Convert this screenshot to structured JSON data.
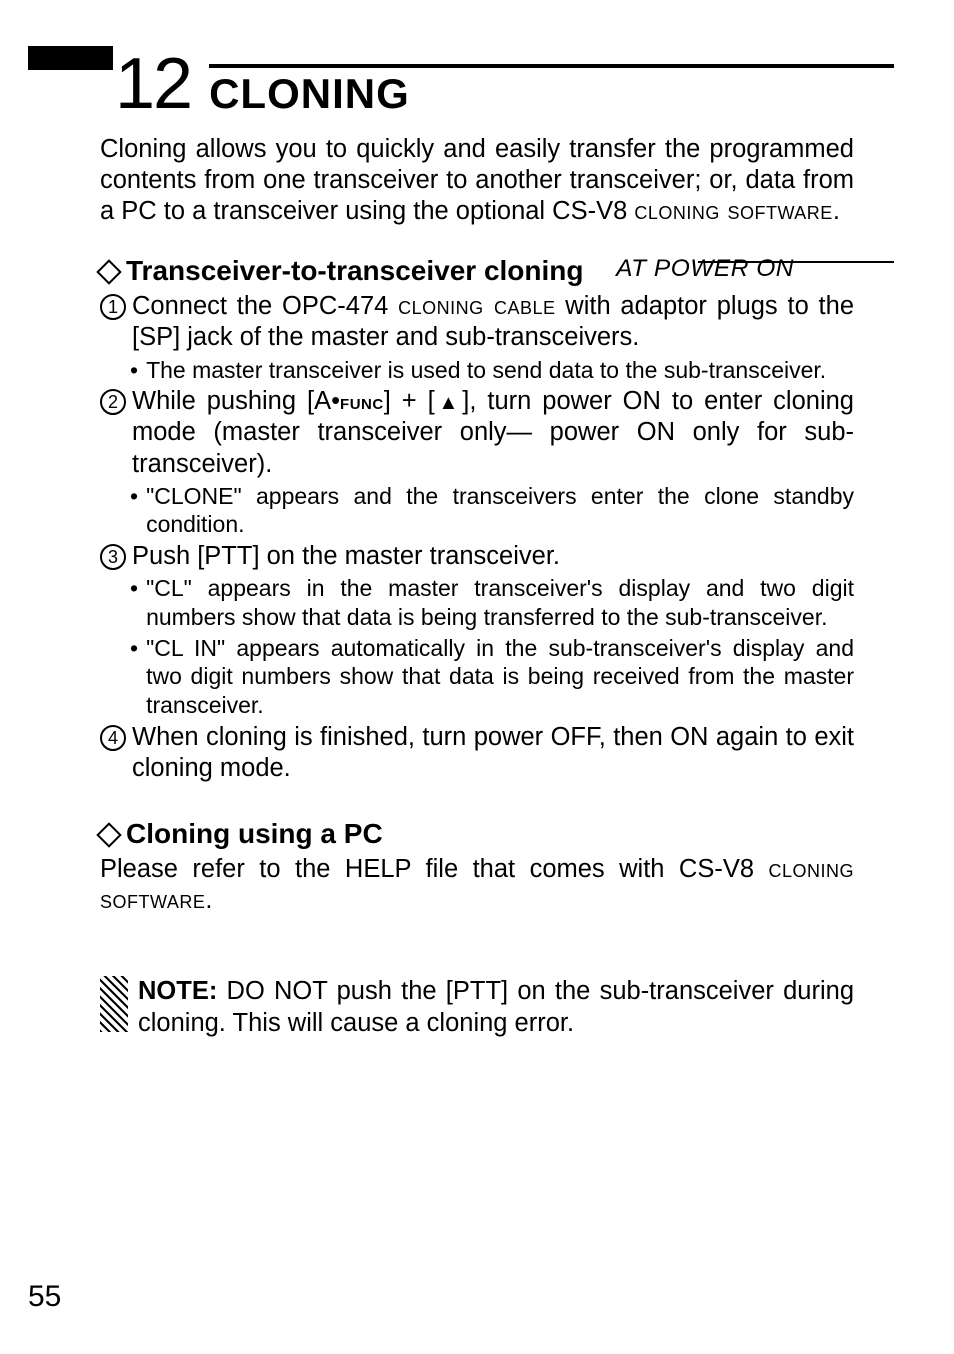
{
  "chapter": {
    "number": "12",
    "title": "CLONING"
  },
  "intro": {
    "p1a": "Cloning allows you to quickly and easily transfer the programmed contents from one transceiver to another transceiver; or, data from a PC to a transceiver using the optional CS-V8 ",
    "p1b": "cloning software",
    "p1c": "."
  },
  "section1": {
    "title": "Transceiver-to-transceiver cloning",
    "power_tag": "AT POWER ON",
    "step1": {
      "num": "1",
      "a": "Connect the OPC-474 ",
      "b": "cloning cable",
      "c": " with adaptor plugs to the [SP] jack of the master and sub-transceivers."
    },
    "step1_bullet": "The master transceiver is used to send data to the sub-transceiver.",
    "step2": {
      "num": "2",
      "a": "While pushing [A•",
      "func": "func",
      "b": "] + [",
      "tri": "▲",
      "c": "], turn power ON to enter cloning mode (master transceiver only— power ON only for sub-transceiver)."
    },
    "step2_bullet": "\"CLONE\" appears and the transceivers enter the clone standby condition.",
    "step3": {
      "num": "3",
      "text": "Push [PTT] on the master transceiver."
    },
    "step3_bullet1": "\"CL\" appears in the master transceiver's display and two digit numbers show that data is being transferred to the sub-transceiver.",
    "step3_bullet2": "\"CL IN\" appears automatically in the sub-transceiver's display and two digit numbers show that data is being received from the master transceiver.",
    "step4": {
      "num": "4",
      "text": "When cloning is finished, turn power OFF, then ON again to exit cloning mode."
    }
  },
  "section2": {
    "title": "Cloning using a PC",
    "a": "Please refer to the HELP file that comes with CS-V8 ",
    "b": "cloning software",
    "c": "."
  },
  "note": {
    "label": "NOTE:",
    "text": " DO NOT push the [PTT] on the sub-transceiver during cloning. This will cause a cloning error."
  },
  "page_number": "55"
}
